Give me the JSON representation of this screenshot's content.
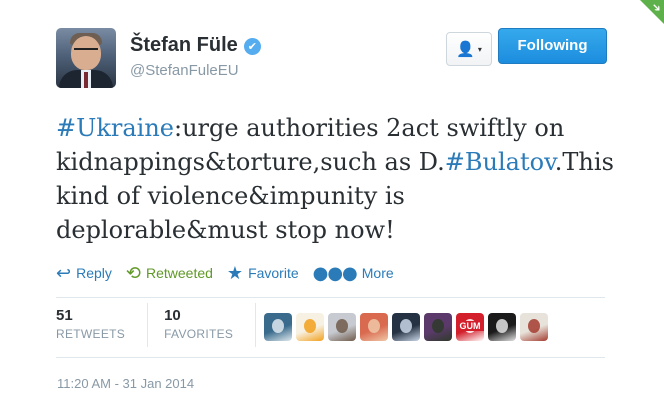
{
  "corner": {
    "icon": "follow-arrow-icon",
    "color": "#5eb14a"
  },
  "profile": {
    "full_name": "Štefan Füle",
    "verified_icon": "verified-badge-icon",
    "verified_glyph": "✔",
    "username": "@StefanFuleEU"
  },
  "header_actions": {
    "user_dropdown_icon": "person-icon",
    "user_dropdown_glyph": "👤",
    "caret_glyph": "▾",
    "follow_label": "Following"
  },
  "tweet": {
    "hashtag1": "#Ukraine",
    "part1": ":urge authorities 2act swiftly on kidnappings&torture,such as D.",
    "hashtag2": "#Bulatov",
    "part2": ".This kind of violence&impunity is deplorable&must stop now!"
  },
  "actions": {
    "reply_label": "Reply",
    "reply_glyph": "↩",
    "retweet_label": "Retweeted",
    "retweet_glyph": "⟲",
    "favorite_label": "Favorite",
    "favorite_glyph": "★",
    "more_label": "More",
    "more_glyph": "●●●"
  },
  "stats": {
    "retweets_count": "51",
    "retweets_label": "RETWEETS",
    "favorites_count": "10",
    "favorites_label": "FAVORITES"
  },
  "favoriters": [
    {
      "name": "favoriter-avatar-1",
      "colors": [
        "#3a6b8c",
        "#dfe8ee"
      ]
    },
    {
      "name": "favoriter-avatar-2",
      "colors": [
        "#f7f1e3",
        "#f2a01c"
      ]
    },
    {
      "name": "favoriter-avatar-3",
      "colors": [
        "#c7cbd1",
        "#6f5a4a"
      ]
    },
    {
      "name": "favoriter-avatar-4",
      "colors": [
        "#d9694f",
        "#f0c8a8"
      ]
    },
    {
      "name": "favoriter-avatar-5",
      "colors": [
        "#243243",
        "#c9d7e8"
      ]
    },
    {
      "name": "favoriter-avatar-6",
      "colors": [
        "#5b3a6b",
        "#2f3a2a"
      ]
    },
    {
      "name": "favoriter-avatar-7",
      "colors": [
        "#d21f2b",
        "#ffffff"
      ]
    },
    {
      "name": "favoriter-avatar-8",
      "colors": [
        "#1b1b1b",
        "#e3e3e3"
      ]
    },
    {
      "name": "favoriter-avatar-9",
      "colors": [
        "#e7e2da",
        "#a33b2e"
      ]
    }
  ],
  "favoriter_7_text": "GUM",
  "timestamp": "11:20 AM - 31 Jan 2014"
}
